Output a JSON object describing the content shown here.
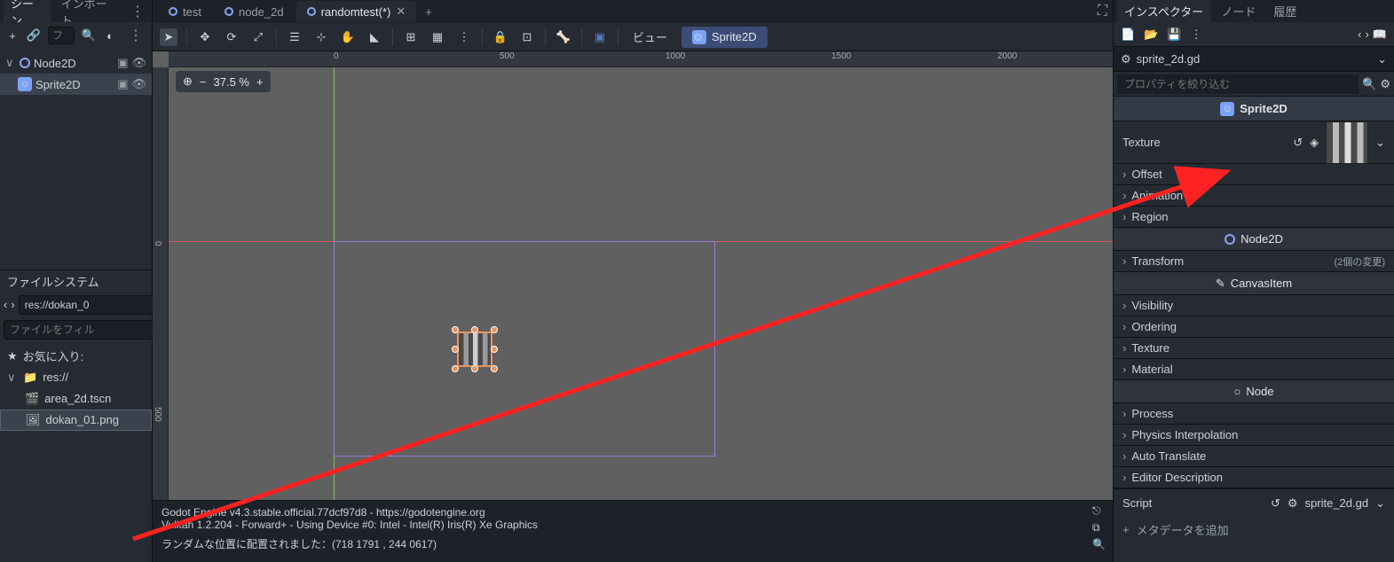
{
  "leftDock": {
    "tabs": {
      "scene": "シーン",
      "import": "インポート"
    },
    "toolbar": {
      "add": "+",
      "link": "🔗",
      "filterPlaceholder": "フ",
      "search": "🔍",
      "tool": "⚙"
    },
    "tree": {
      "root": "Node2D",
      "child": "Sprite2D"
    }
  },
  "fileSystem": {
    "title": "ファイルシステム",
    "path": "res://dokan_0",
    "filterPlaceholder": "ファイルをフィル",
    "favorites": "お気に入り:",
    "resRoot": "res://",
    "items": {
      "scene": "area_2d.tscn",
      "image": "dokan_01.png"
    }
  },
  "sceneTabs": [
    {
      "label": "test",
      "active": false
    },
    {
      "label": "node_2d",
      "active": false
    },
    {
      "label": "randomtest(*)",
      "active": true
    }
  ],
  "canvasToolbar": {
    "view": "ビュー",
    "mode": "Sprite2D"
  },
  "zoom": {
    "value": "37.5 %"
  },
  "rulerTop": [
    "0",
    "500",
    "1000",
    "1500",
    "2000"
  ],
  "rulerLeft": [
    "0",
    "500"
  ],
  "output": {
    "line1": "Godot Engine v4.3.stable.official.77dcf97d8 - https://godotengine.org",
    "line2": "Vulkan 1.2.204 - Forward+ - Using Device #0: Intel - Intel(R) Iris(R) Xe Graphics",
    "line3": "ランダムな位置に配置されました：(718 1791 , 244 0617)"
  },
  "inspector": {
    "tabs": {
      "inspector": "インスペクター",
      "node": "ノード",
      "history": "履歴"
    },
    "scriptName": "sprite_2d.gd",
    "filterPlaceholder": "プロパティを絞り込む",
    "class1": "Sprite2D",
    "texture": {
      "label": "Texture"
    },
    "groups1": [
      "Offset",
      "Animation",
      "Region"
    ],
    "class2": "Node2D",
    "transform": {
      "label": "Transform",
      "extra": "(2個の変更)"
    },
    "class3": "CanvasItem",
    "groups3": [
      "Visibility",
      "Ordering",
      "Texture",
      "Material"
    ],
    "class4": "Node",
    "groups4": [
      "Process",
      "Physics Interpolation",
      "Auto Translate",
      "Editor Description"
    ],
    "scriptProp": {
      "label": "Script",
      "value": "sprite_2d.gd"
    },
    "metaButton": "メタデータを追加"
  }
}
